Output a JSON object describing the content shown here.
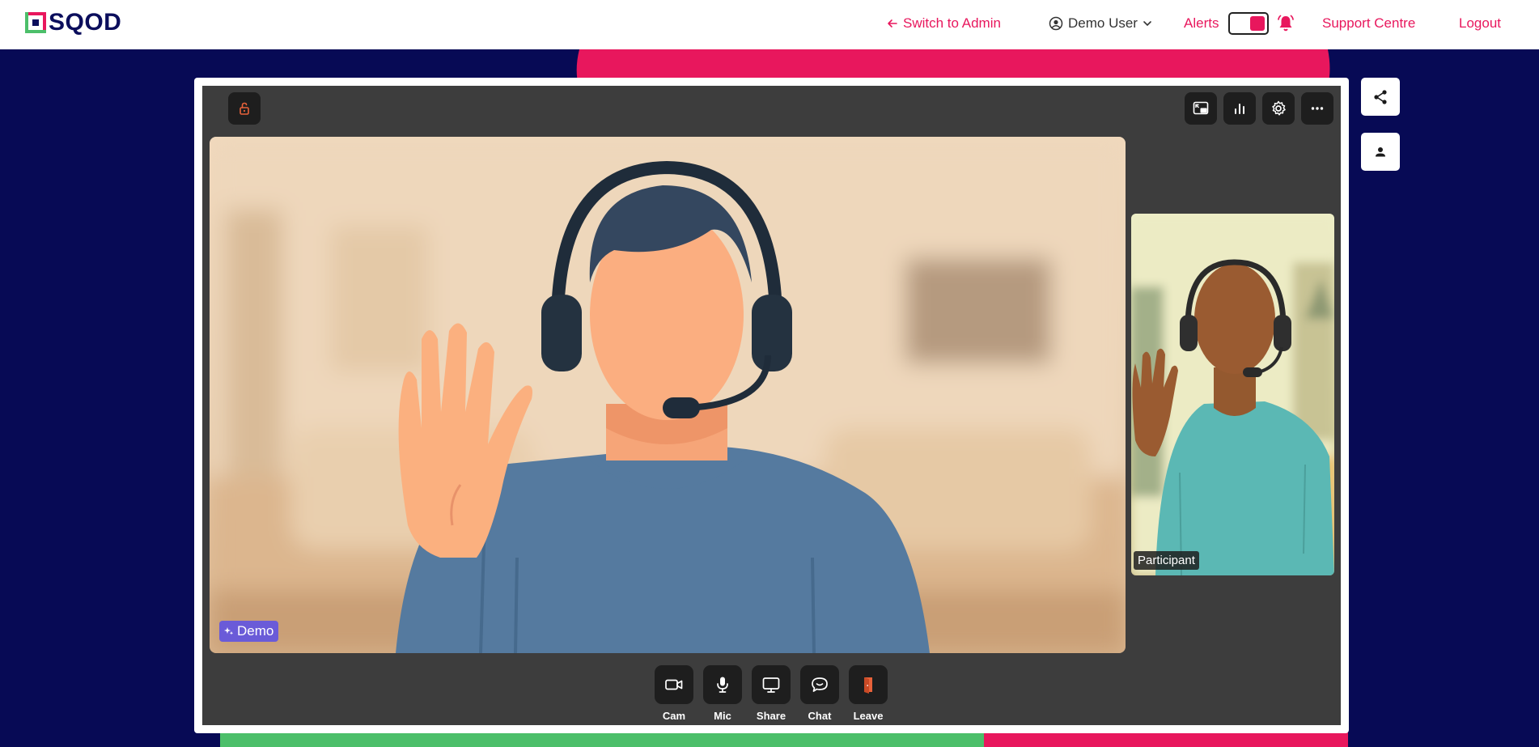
{
  "brand": {
    "name": "SQOD"
  },
  "nav": {
    "switch_admin": "Switch to Admin",
    "user_name": "Demo User",
    "alerts": "Alerts",
    "support": "Support Centre",
    "logout": "Logout",
    "alerts_enabled": true
  },
  "video": {
    "main_tag": "Demo",
    "self_tag": "Participant"
  },
  "top_tools": [
    {
      "icon": "picture-in-picture-icon"
    },
    {
      "icon": "stats-icon"
    },
    {
      "icon": "gear-icon"
    },
    {
      "icon": "more-icon"
    }
  ],
  "controls": {
    "cam": "Cam",
    "mic": "Mic",
    "share": "Share",
    "chat": "Chat",
    "leave": "Leave"
  },
  "colors": {
    "brand_pink": "#e8175d",
    "brand_green": "#4cbf6a",
    "navy": "#070a55",
    "stage": "#3d3d3d",
    "leave_icon": "#e8623a",
    "demo_tag": "#6a5bd8"
  }
}
